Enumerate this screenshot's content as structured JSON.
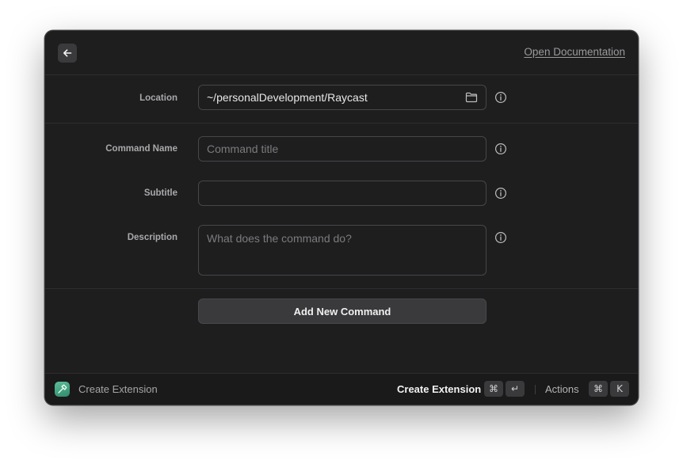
{
  "header": {
    "back_icon": "arrow-left-icon",
    "doc_link": "Open Documentation"
  },
  "location": {
    "label": "Location",
    "value": "~/personalDevelopment/Raycast",
    "icon": "folder-icon"
  },
  "command_name": {
    "label": "Command Name",
    "placeholder": "Command title"
  },
  "subtitle": {
    "label": "Subtitle",
    "value": ""
  },
  "description": {
    "label": "Description",
    "placeholder": "What does the command do?"
  },
  "add_button": "Add New Command",
  "footer": {
    "title": "Create Extension",
    "primary_action": "Create Extension",
    "primary_keys": [
      "⌘",
      "↵"
    ],
    "secondary_action": "Actions",
    "secondary_keys": [
      "⌘",
      "K"
    ]
  },
  "colors": {
    "background": "#1e1e1f",
    "accent_icon": "#3fa882"
  }
}
